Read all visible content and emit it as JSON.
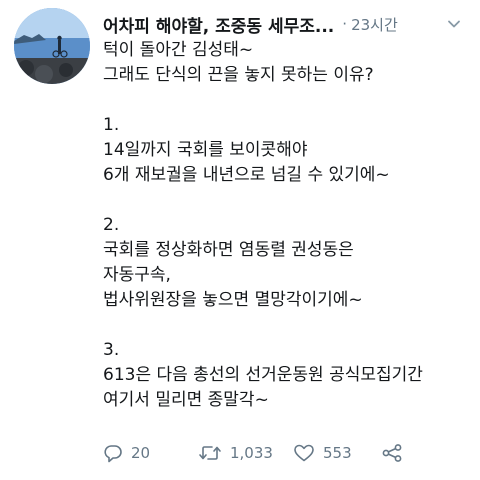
{
  "tweet": {
    "author_name": "어차피 해야할, 조중동  세무조...",
    "separator": "·",
    "time": "23시간",
    "lines": [
      "턱이 돌아간 김성태~",
      "그래도 단식의 끈을 놓지 못하는 이유?",
      "",
      "1.",
      "14일까지 국회를 보이콧해야",
      "6개 재보궐을 내년으로 넘길 수 있기에~",
      "",
      "2.",
      "국회를 정상화하면 염동렬 권성동은",
      "자동구속,",
      "법사위원장을 놓으면 멸망각이기에~",
      "",
      "3.",
      "613은 다음 총선의 선거운동원 공식모집기간",
      "여기서 밀리면 종말각~"
    ],
    "reply_count": "20",
    "retweet_count": "1,033",
    "like_count": "553"
  },
  "colors": {
    "text": "#14171a",
    "secondary": "#657786"
  },
  "icons": {
    "reply": "speech-bubble",
    "retweet": "retweet-arrows",
    "like": "heart-outline",
    "share": "share-nodes",
    "menu": "chevron-down"
  }
}
